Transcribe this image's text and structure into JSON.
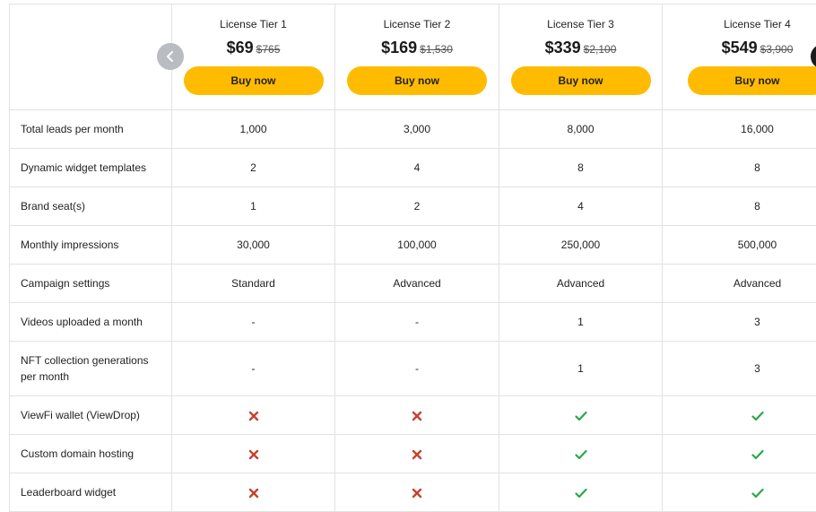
{
  "tiers": [
    {
      "name": "License Tier 1",
      "price": "$69",
      "old_price": "$765",
      "cta": "Buy now"
    },
    {
      "name": "License Tier 2",
      "price": "$169",
      "old_price": "$1,530",
      "cta": "Buy now"
    },
    {
      "name": "License Tier 3",
      "price": "$339",
      "old_price": "$2,100",
      "cta": "Buy now"
    },
    {
      "name": "License Tier 4",
      "price": "$549",
      "old_price": "$3,900",
      "cta": "Buy now"
    }
  ],
  "features": [
    {
      "label": "Total leads per month",
      "values": [
        "1,000",
        "3,000",
        "8,000",
        "16,000"
      ]
    },
    {
      "label": "Dynamic widget templates",
      "values": [
        "2",
        "4",
        "8",
        "8"
      ]
    },
    {
      "label": "Brand seat(s)",
      "values": [
        "1",
        "2",
        "4",
        "8"
      ]
    },
    {
      "label": "Monthly impressions",
      "values": [
        "30,000",
        "100,000",
        "250,000",
        "500,000"
      ]
    },
    {
      "label": "Campaign settings",
      "values": [
        "Standard",
        "Advanced",
        "Advanced",
        "Advanced"
      ]
    },
    {
      "label": "Videos uploaded a month",
      "values": [
        "-",
        "-",
        "1",
        "3"
      ]
    },
    {
      "label": "NFT collection generations per month",
      "values": [
        "-",
        "-",
        "1",
        "3"
      ]
    },
    {
      "label": "ViewFi wallet (ViewDrop)",
      "values": [
        "cross",
        "cross",
        "check",
        "check"
      ]
    },
    {
      "label": "Custom domain hosting",
      "values": [
        "cross",
        "cross",
        "check",
        "check"
      ]
    },
    {
      "label": "Leaderboard widget",
      "values": [
        "cross",
        "cross",
        "check",
        "check"
      ]
    }
  ],
  "icons": {
    "prev": "chevron-left-icon",
    "next": "chevron-right-icon",
    "yes": "check-icon",
    "no": "cross-icon"
  },
  "colors": {
    "button": "#ffbb00",
    "check": "#2aa84a",
    "cross": "#c8412a",
    "prev_arrow": "#b9bcc1",
    "next_arrow": "#1b1b1b"
  }
}
